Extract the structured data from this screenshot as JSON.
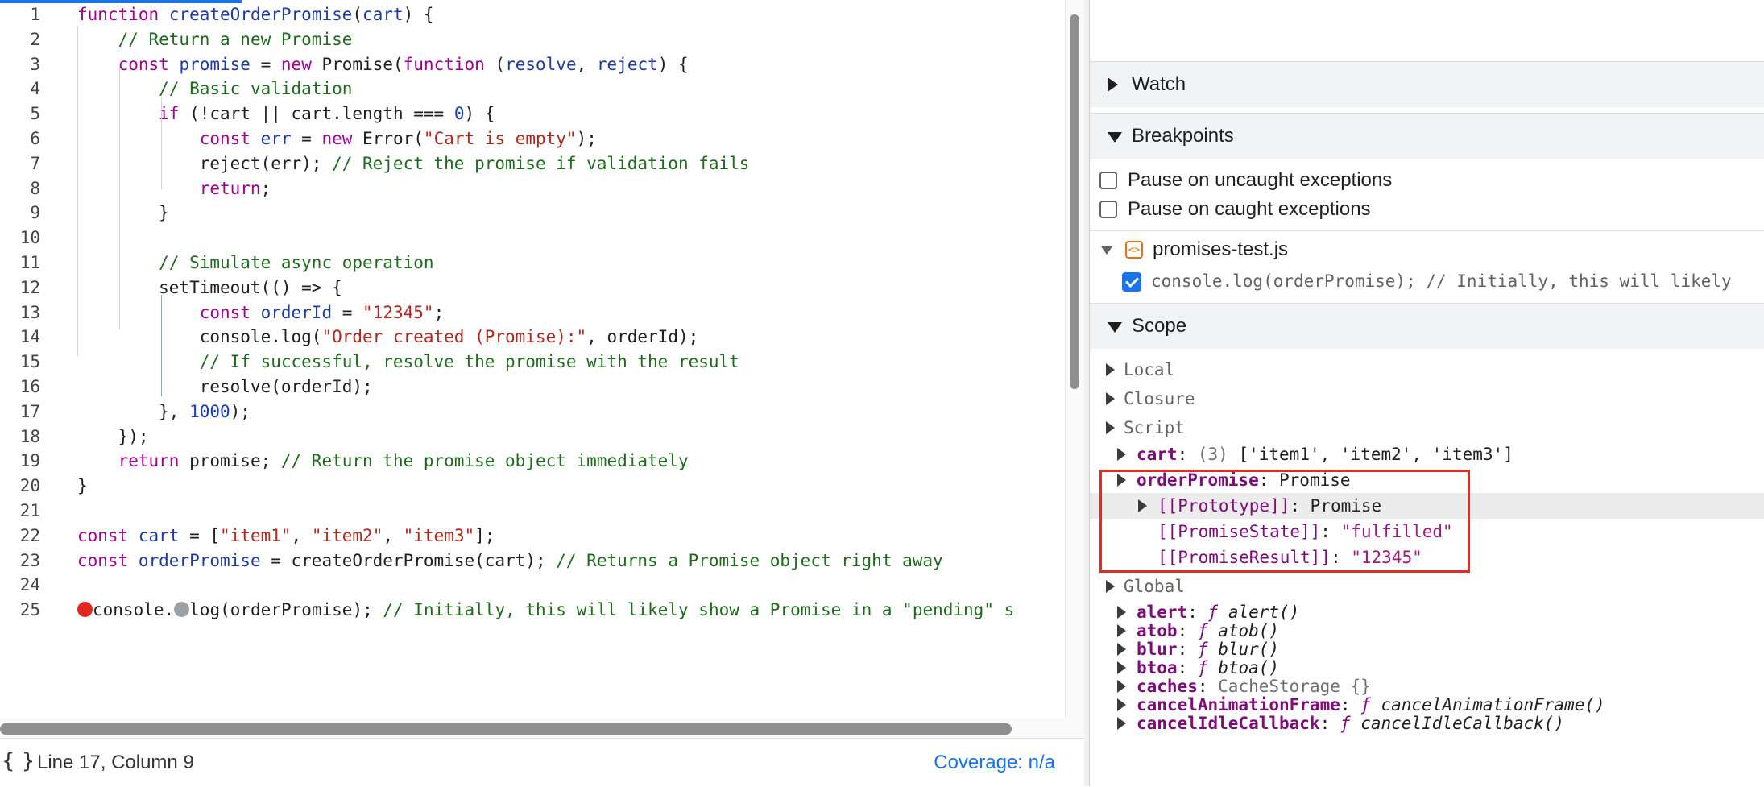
{
  "editor": {
    "lines": [
      {
        "n": "1",
        "segs": [
          [
            "kw",
            "function"
          ],
          [
            "t",
            " "
          ],
          [
            "id",
            "createOrderPromise"
          ],
          [
            "t",
            "("
          ],
          [
            "id",
            "cart"
          ],
          [
            "t",
            ") {"
          ]
        ]
      },
      {
        "n": "2",
        "segs": [
          [
            "t",
            "    "
          ],
          [
            "cm",
            "// Return a new Promise"
          ]
        ]
      },
      {
        "n": "3",
        "segs": [
          [
            "t",
            "    "
          ],
          [
            "kw",
            "const"
          ],
          [
            "t",
            " "
          ],
          [
            "id",
            "promise"
          ],
          [
            "t",
            " = "
          ],
          [
            "kw",
            "new"
          ],
          [
            "t",
            " Promise("
          ],
          [
            "kw",
            "function"
          ],
          [
            "t",
            " ("
          ],
          [
            "id",
            "resolve"
          ],
          [
            "t",
            ", "
          ],
          [
            "id",
            "reject"
          ],
          [
            "t",
            ") {"
          ]
        ]
      },
      {
        "n": "4",
        "segs": [
          [
            "t",
            "        "
          ],
          [
            "cm",
            "// Basic validation"
          ]
        ]
      },
      {
        "n": "5",
        "segs": [
          [
            "t",
            "        "
          ],
          [
            "kw",
            "if"
          ],
          [
            "t",
            " (!cart || cart.length === "
          ],
          [
            "num",
            "0"
          ],
          [
            "t",
            ") {"
          ]
        ]
      },
      {
        "n": "6",
        "segs": [
          [
            "t",
            "            "
          ],
          [
            "kw",
            "const"
          ],
          [
            "t",
            " "
          ],
          [
            "id",
            "err"
          ],
          [
            "t",
            " = "
          ],
          [
            "kw",
            "new"
          ],
          [
            "t",
            " Error("
          ],
          [
            "str",
            "\"Cart is empty\""
          ],
          [
            "t",
            ");"
          ]
        ]
      },
      {
        "n": "7",
        "segs": [
          [
            "t",
            "            reject(err); "
          ],
          [
            "cm",
            "// Reject the promise if validation fails"
          ]
        ]
      },
      {
        "n": "8",
        "segs": [
          [
            "t",
            "            "
          ],
          [
            "kw",
            "return"
          ],
          [
            "t",
            ";"
          ]
        ]
      },
      {
        "n": "9",
        "segs": [
          [
            "t",
            "        }"
          ]
        ]
      },
      {
        "n": "10",
        "segs": [
          [
            "t",
            ""
          ]
        ]
      },
      {
        "n": "11",
        "segs": [
          [
            "t",
            "        "
          ],
          [
            "cm",
            "// Simulate async operation"
          ]
        ]
      },
      {
        "n": "12",
        "segs": [
          [
            "t",
            "        setTimeout(() => {"
          ]
        ]
      },
      {
        "n": "13",
        "segs": [
          [
            "t",
            "            "
          ],
          [
            "kw",
            "const"
          ],
          [
            "t",
            " "
          ],
          [
            "id",
            "orderId"
          ],
          [
            "t",
            " = "
          ],
          [
            "str",
            "\"12345\""
          ],
          [
            "t",
            ";"
          ]
        ]
      },
      {
        "n": "14",
        "segs": [
          [
            "t",
            "            console.log("
          ],
          [
            "str",
            "\"Order created (Promise):\""
          ],
          [
            "t",
            ", orderId);"
          ]
        ]
      },
      {
        "n": "15",
        "segs": [
          [
            "t",
            "            "
          ],
          [
            "cm",
            "// If successful, resolve the promise with the result"
          ]
        ]
      },
      {
        "n": "16",
        "segs": [
          [
            "t",
            "            resolve(orderId);"
          ]
        ]
      },
      {
        "n": "17",
        "segs": [
          [
            "t",
            "        }, "
          ],
          [
            "num",
            "1000"
          ],
          [
            "t",
            ");"
          ]
        ]
      },
      {
        "n": "18",
        "segs": [
          [
            "t",
            "    });"
          ]
        ]
      },
      {
        "n": "19",
        "segs": [
          [
            "t",
            "    "
          ],
          [
            "kw",
            "return"
          ],
          [
            "t",
            " promise; "
          ],
          [
            "cm",
            "// Return the promise object immediately"
          ]
        ]
      },
      {
        "n": "20",
        "segs": [
          [
            "t",
            "}"
          ]
        ]
      },
      {
        "n": "21",
        "segs": [
          [
            "t",
            ""
          ]
        ]
      },
      {
        "n": "22",
        "segs": [
          [
            "kw",
            "const"
          ],
          [
            "t",
            " "
          ],
          [
            "id",
            "cart"
          ],
          [
            "t",
            " = ["
          ],
          [
            "str",
            "\"item1\""
          ],
          [
            "t",
            ", "
          ],
          [
            "str",
            "\"item2\""
          ],
          [
            "t",
            ", "
          ],
          [
            "str",
            "\"item3\""
          ],
          [
            "t",
            "];"
          ]
        ]
      },
      {
        "n": "23",
        "segs": [
          [
            "kw",
            "const"
          ],
          [
            "t",
            " "
          ],
          [
            "id",
            "orderPromise"
          ],
          [
            "t",
            " = createOrderPromise(cart); "
          ],
          [
            "cm",
            "// Returns a Promise object right away"
          ]
        ]
      },
      {
        "n": "24",
        "segs": [
          [
            "t",
            ""
          ]
        ]
      },
      {
        "n": "25",
        "segs": [
          [
            "bpr",
            ""
          ],
          [
            "t",
            "console."
          ],
          [
            "bpg",
            ""
          ],
          [
            "t",
            "log(orderPromise); "
          ],
          [
            "cm",
            "// Initially, this will likely show a Promise in a \"pending\" s"
          ]
        ]
      }
    ]
  },
  "status": {
    "braces": "{ }",
    "cursor": "Line 17, Column 9",
    "coverage": "Coverage: n/a"
  },
  "panel": {
    "watch_label": "Watch",
    "breakpoints_label": "Breakpoints",
    "pause_uncaught": "Pause on uncaught exceptions",
    "pause_caught": "Pause on caught exceptions",
    "file_name": "promises-test.js",
    "file_icon": "<>",
    "breakpoint_code": "console.log(orderPromise); // Initially, this will likely",
    "scope_label": "Scope"
  },
  "scope": {
    "local": "Local",
    "closure": "Closure",
    "script": "Script",
    "cart": {
      "name": "cart",
      "count": "(3)",
      "value": "['item1', 'item2', 'item3']"
    },
    "orderPromise": {
      "name": "orderPromise",
      "value": "Promise"
    },
    "prototype": {
      "name": "[[Prototype]]",
      "value": "Promise"
    },
    "promiseState": {
      "name": "[[PromiseState]]",
      "value": "\"fulfilled\""
    },
    "promiseResult": {
      "name": "[[PromiseResult]]",
      "value": "\"12345\""
    },
    "global": "Global",
    "globals": [
      {
        "name": "alert",
        "f": "ƒ",
        "fn": "alert()"
      },
      {
        "name": "atob",
        "f": "ƒ",
        "fn": "atob()"
      },
      {
        "name": "blur",
        "f": "ƒ",
        "fn": "blur()"
      },
      {
        "name": "btoa",
        "f": "ƒ",
        "fn": "btoa()"
      },
      {
        "name": "caches",
        "f": "",
        "fn": "CacheStorage {}"
      },
      {
        "name": "cancelAnimationFrame",
        "f": "ƒ",
        "fn": "cancelAnimationFrame()"
      },
      {
        "name": "cancelIdleCallback",
        "f": "ƒ",
        "fn": "cancelIdleCallback()"
      }
    ]
  }
}
